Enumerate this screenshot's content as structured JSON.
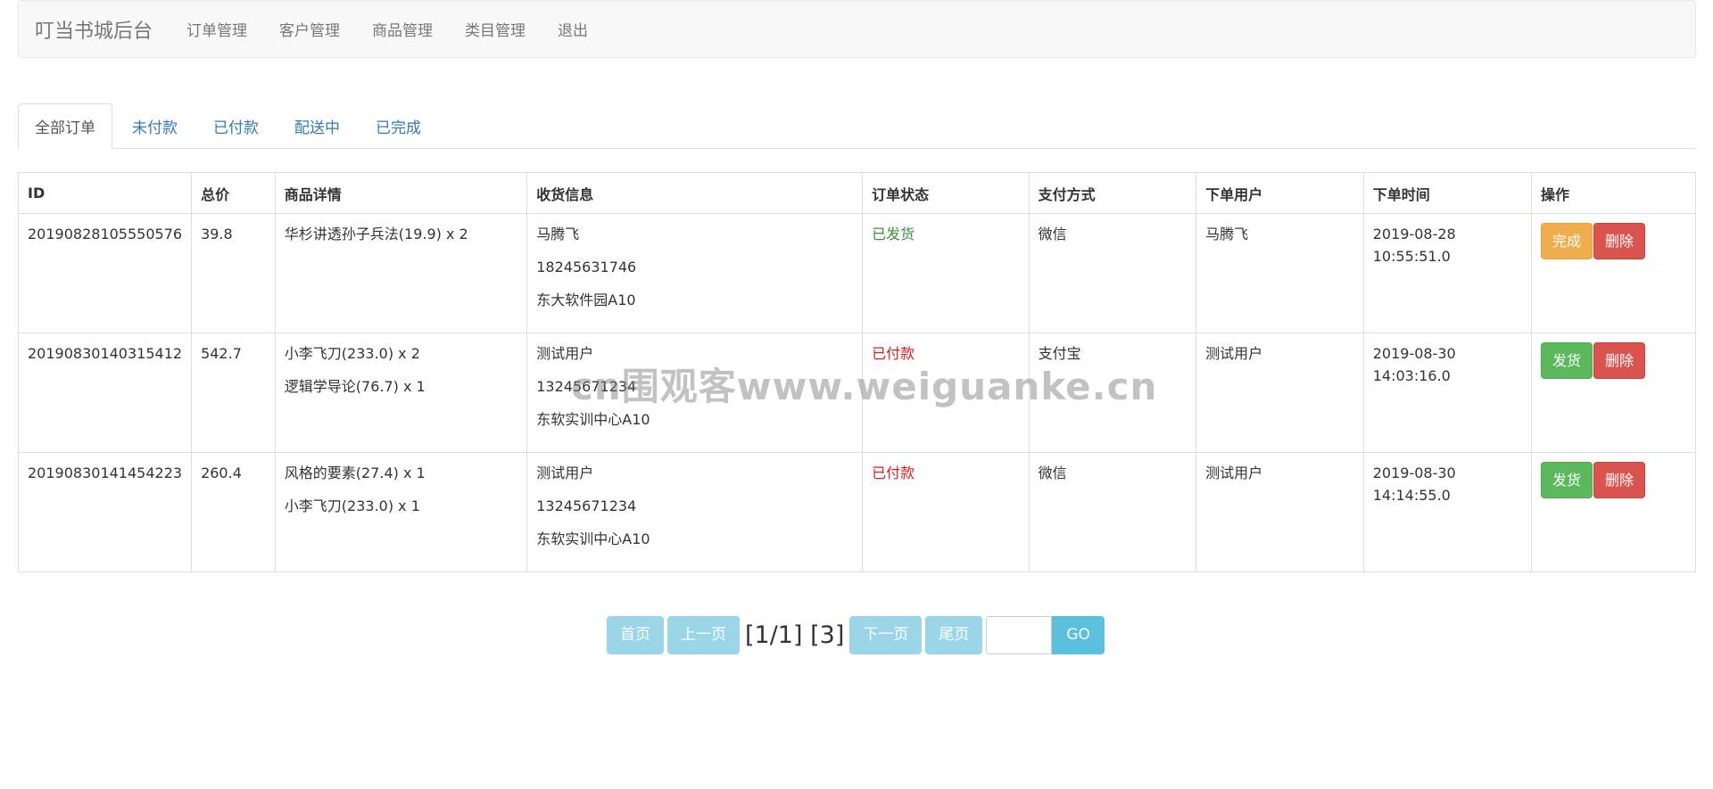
{
  "navbar": {
    "brand": "叮当书城后台",
    "items": [
      "订单管理",
      "客户管理",
      "商品管理",
      "类目管理",
      "退出"
    ]
  },
  "tabs": [
    "全部订单",
    "未付款",
    "已付款",
    "配送中",
    "已完成"
  ],
  "table": {
    "headers": [
      "ID",
      "总价",
      "商品详情",
      "收货信息",
      "订单状态",
      "支付方式",
      "下单用户",
      "下单时间",
      "操作"
    ],
    "rows": [
      {
        "id": "20190828105550576",
        "total": "39.8",
        "items": [
          "华杉讲透孙子兵法(19.9) x 2"
        ],
        "shipping": [
          "马腾飞",
          "18245631746",
          "东大软件园A10"
        ],
        "status": "已发货",
        "payment": "微信",
        "user": "马腾飞",
        "date": "2019-08-28",
        "time": "10:55:51.0",
        "action": "完成",
        "delete": "删除"
      },
      {
        "id": "20190830140315412",
        "total": "542.7",
        "items": [
          "小李飞刀(233.0) x 2",
          "逻辑学导论(76.7) x 1"
        ],
        "shipping": [
          "测试用户",
          "13245671234",
          "东软实训中心A10"
        ],
        "status": "已付款",
        "payment": "支付宝",
        "user": "测试用户",
        "date": "2019-08-30",
        "time": "14:03:16.0",
        "action": "发货",
        "delete": "删除"
      },
      {
        "id": "20190830141454223",
        "total": "260.4",
        "items": [
          "风格的要素(27.4) x 1",
          "小李飞刀(233.0) x 1"
        ],
        "shipping": [
          "测试用户",
          "13245671234",
          "东软实训中心A10"
        ],
        "status": "已付款",
        "payment": "微信",
        "user": "测试用户",
        "date": "2019-08-30",
        "time": "14:14:55.0",
        "action": "发货",
        "delete": "删除"
      }
    ]
  },
  "pager": {
    "first": "首页",
    "prev": "上一页",
    "info": "[1/1] [3]",
    "next": "下一页",
    "last": "尾页",
    "input_value": "",
    "go": "GO"
  },
  "watermark": "cn围观客www.weiguanke.cn",
  "colors": {
    "shipped": "#3c8f3c",
    "paid": "#e21b1b",
    "warning": "#f0ad4e",
    "success": "#5cb85c",
    "danger": "#d9534f",
    "link": "#337ab7"
  }
}
